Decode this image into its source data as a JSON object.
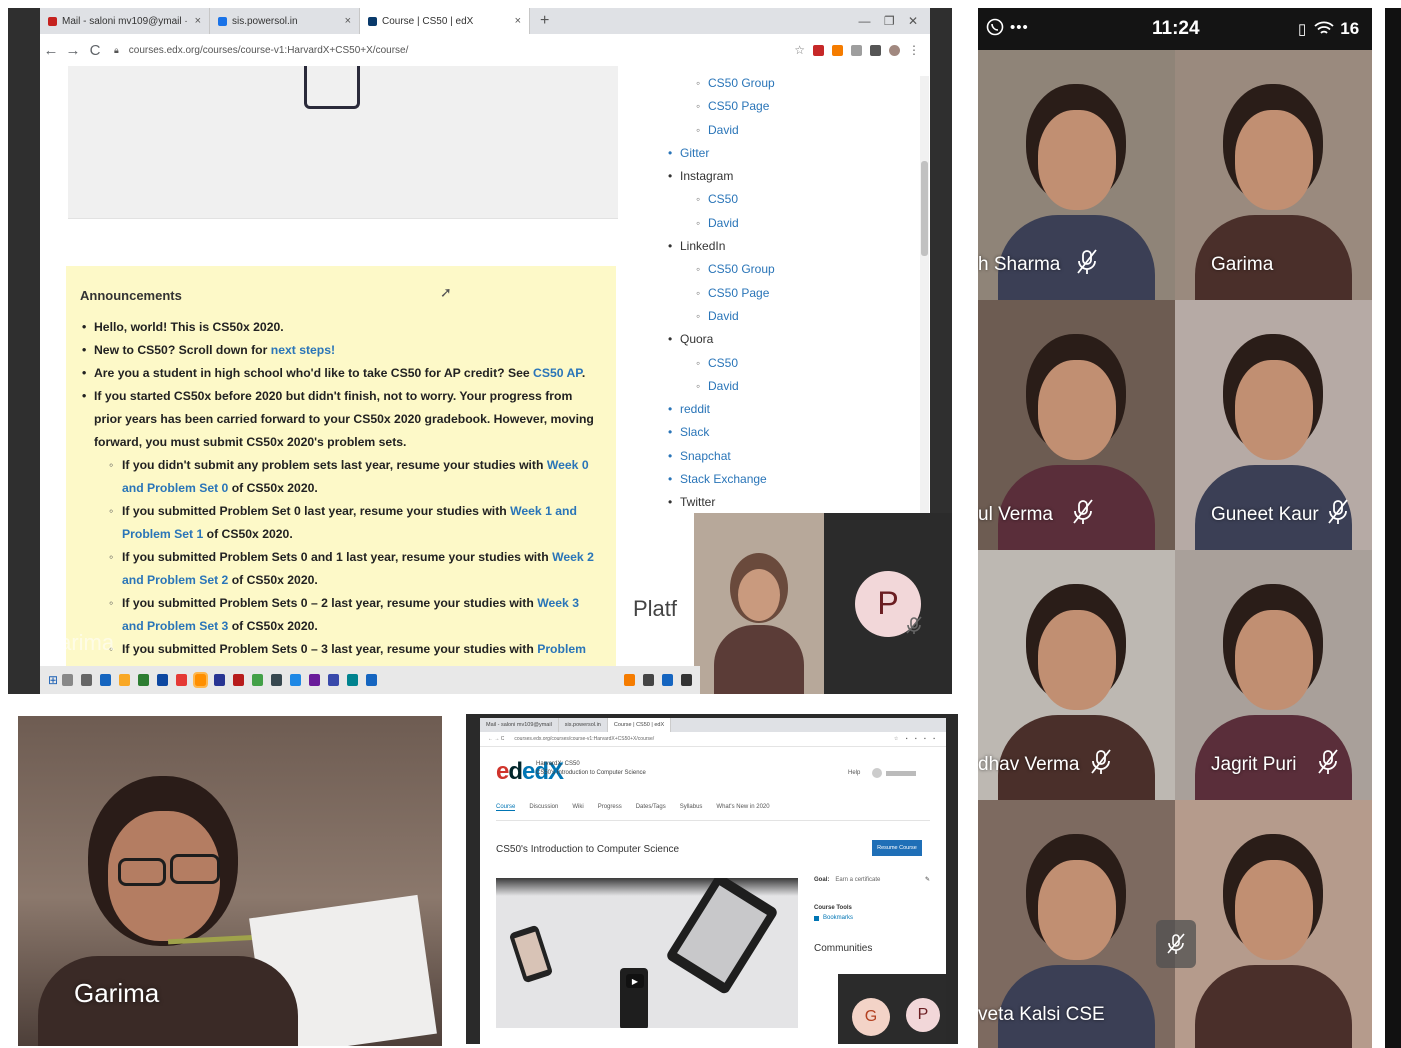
{
  "browser": {
    "tabs": [
      {
        "label": "Mail - saloni mv109@ymail ·",
        "color": "#c5221f"
      },
      {
        "label": "sis.powersol.in",
        "color": "#1a73e8"
      },
      {
        "label": "Course | CS50 | edX",
        "color": "#0a3a6b"
      }
    ],
    "new_tab": "+",
    "url": "courses.edx.org/courses/course-v1:HarvardX+CS50+X/course/",
    "nav": {
      "back": "←",
      "forward": "→",
      "reload": "C"
    },
    "announcements": {
      "title": "Announcements",
      "items": [
        {
          "text": "Hello, world! This is CS50x 2020.",
          "level": 1
        },
        {
          "text": "New to CS50? Scroll down for ",
          "link": "next steps!",
          "level": 1
        },
        {
          "text": "Are you a student in high school who'd like to take CS50 for AP credit? See ",
          "link": "CS50 AP",
          "tail": ".",
          "level": 1
        },
        {
          "text": "If you started CS50x before 2020 but didn't finish, not to worry. Your progress from prior years has been carried forward to your CS50x 2020 gradebook. However, moving forward, you must submit CS50x 2020's problem sets.",
          "level": 1
        },
        {
          "text": "If you didn't submit any problem sets last year, resume your studies with ",
          "link": "Week 0 and Problem Set 0",
          "tail": " of CS50x 2020.",
          "level": 2
        },
        {
          "text": "If you submitted Problem Set 0 last year, resume your studies with ",
          "link": "Week 1 and Problem Set 1",
          "tail": " of CS50x 2020.",
          "level": 2
        },
        {
          "text": "If you submitted Problem Sets 0 and 1 last year, resume your studies with ",
          "link": "Week 2 and Problem Set 2",
          "tail": " of CS50x 2020.",
          "level": 2
        },
        {
          "text": "If you submitted Problem Sets 0 – 2 last year, resume your studies with ",
          "link": "Week 3 and Problem Set 3",
          "tail": " of CS50x 2020.",
          "level": 2
        },
        {
          "text": "If you submitted Problem Sets 0 – 3 last year, resume your studies with ",
          "link": "Problem Set",
          "level": 2
        }
      ]
    },
    "social": [
      {
        "text": "CS50 Group",
        "level": 2
      },
      {
        "text": "CS50 Page",
        "level": 2
      },
      {
        "text": "David",
        "level": 2
      },
      {
        "text": "Gitter",
        "level": 1,
        "link": true
      },
      {
        "text": "Instagram",
        "level": 1
      },
      {
        "text": "CS50",
        "level": 2
      },
      {
        "text": "David",
        "level": 2
      },
      {
        "text": "LinkedIn",
        "level": 1
      },
      {
        "text": "CS50 Group",
        "level": 2
      },
      {
        "text": "CS50 Page",
        "level": 2
      },
      {
        "text": "David",
        "level": 2
      },
      {
        "text": "Quora",
        "level": 1
      },
      {
        "text": "CS50",
        "level": 2
      },
      {
        "text": "David",
        "level": 2
      },
      {
        "text": "reddit",
        "level": 1,
        "link": true
      },
      {
        "text": "Slack",
        "level": 1,
        "link": true
      },
      {
        "text": "Snapchat",
        "level": 1,
        "link": true
      },
      {
        "text": "Stack Exchange",
        "level": 1,
        "link": true
      },
      {
        "text": "Twitter",
        "level": 1
      }
    ],
    "platf_heading": "Platf",
    "tile_initial": "P",
    "watermark_name": "Garima"
  },
  "phone": {
    "time": "11:24",
    "battery": "16",
    "participants": [
      {
        "name": "h Sharma",
        "muted": true,
        "bg": "#8f8478"
      },
      {
        "name": "Garima",
        "muted": false,
        "bg": "#9a8a7e"
      },
      {
        "name": "ul Verma",
        "muted": true,
        "bg": "#6d5c52"
      },
      {
        "name": "Guneet Kaur",
        "muted": true,
        "bg": "#b6aaa5"
      },
      {
        "name": "dhav Verma",
        "muted": true,
        "bg": "#bdb8b2"
      },
      {
        "name": "Jagrit Puri",
        "muted": true,
        "bg": "#a9a09a"
      },
      {
        "name": "veta Kalsi CSE",
        "muted": false,
        "bg": "#7d6a60"
      },
      {
        "name": "",
        "muted": false,
        "bg": "#b59b8c"
      }
    ]
  },
  "photo": {
    "name": "Garima"
  },
  "edx": {
    "tabs": [
      "Mail - saloni mv109@ymail",
      "sis.powersol.in",
      "Course | CS50 | edX"
    ],
    "url": "courses.edx.org/courses/course-v1:HarvardX+CS50+X/course/",
    "logo": "edX",
    "course_org": "HarvardX: CS50",
    "course_name": "CS50's Introduction to Computer Science",
    "help": "Help",
    "nav": [
      "Course",
      "Discussion",
      "Wiki",
      "Progress",
      "Dates/Tags",
      "Syllabus",
      "What's New in 2020"
    ],
    "course_title": "CS50's Introduction to Computer Science",
    "resume_button": "Resume Course",
    "goal_label": "Goal:",
    "goal_value": "Earn a certificate",
    "course_tools": "Course Tools",
    "bookmarks": "Bookmarks",
    "communities": "Communities",
    "bubble_g": "G",
    "bubble_p": "P"
  }
}
